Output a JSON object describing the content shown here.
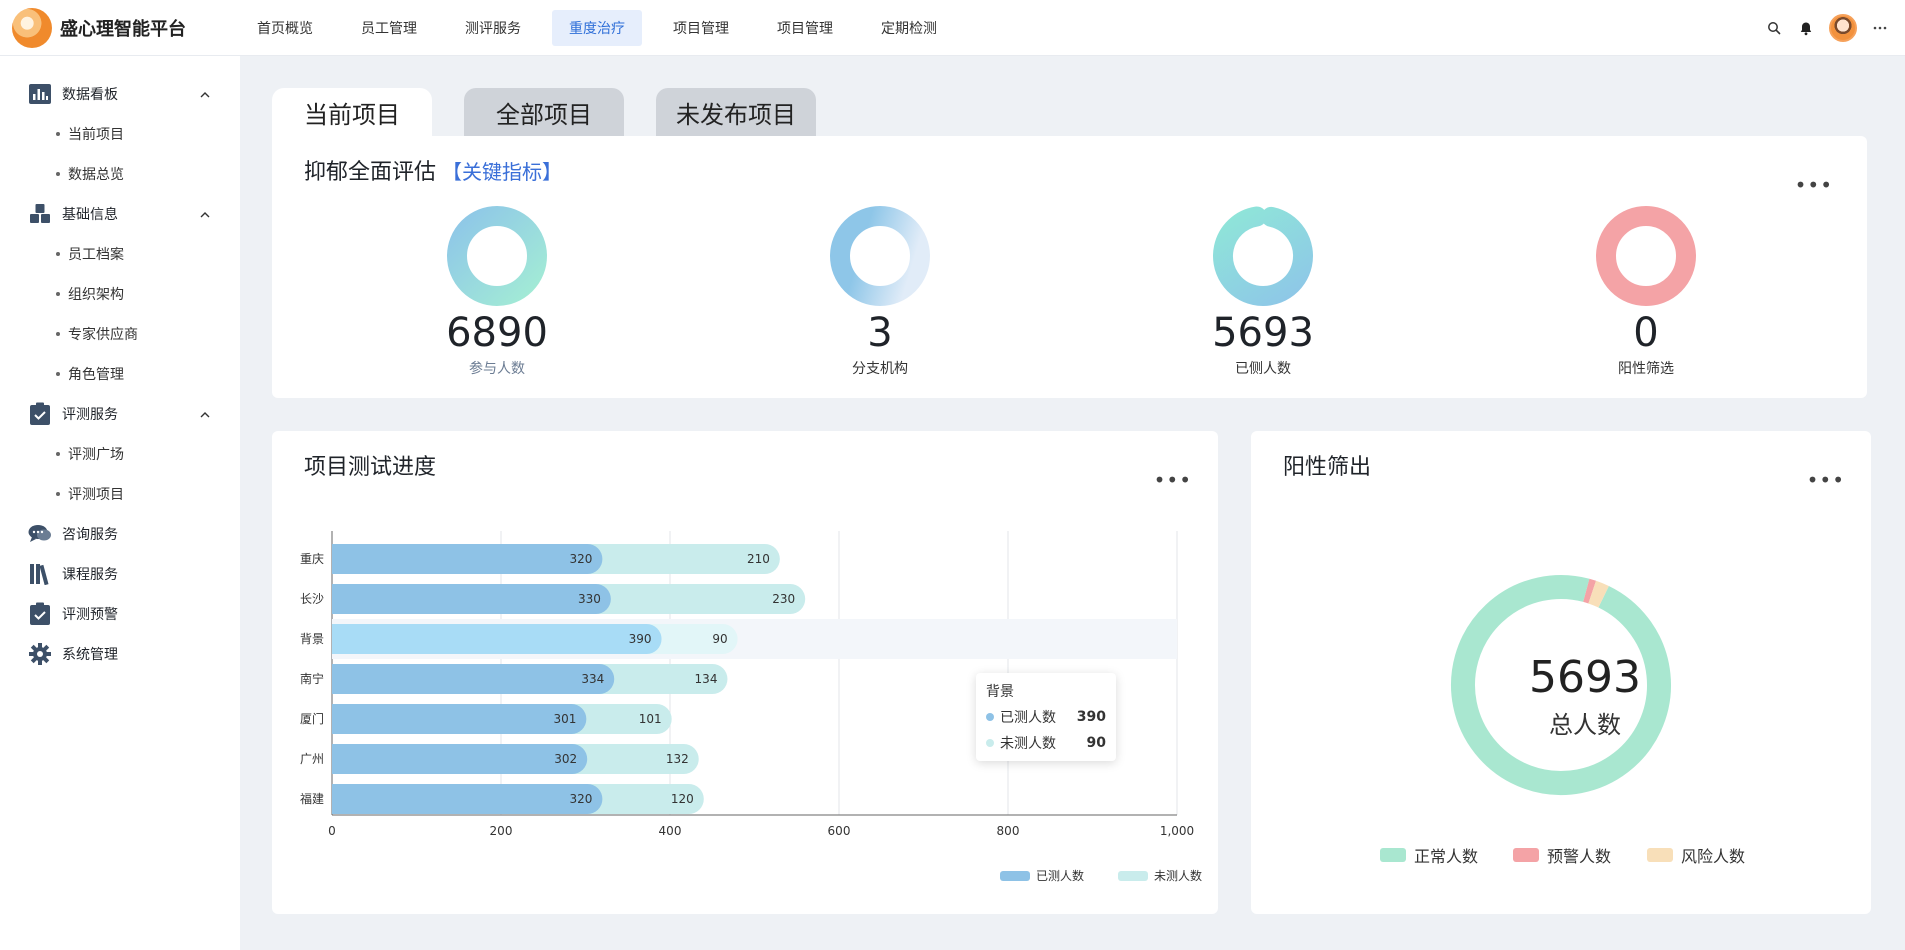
{
  "app": {
    "name": "盛心理智能平台"
  },
  "nav": [
    {
      "label": "首页概览",
      "active": false
    },
    {
      "label": "员工管理",
      "active": false
    },
    {
      "label": "测评服务",
      "active": false
    },
    {
      "label": "重度治疗",
      "active": true
    },
    {
      "label": "项目管理",
      "active": false
    },
    {
      "label": "项目管理",
      "active": false
    },
    {
      "label": "定期检测",
      "active": false
    }
  ],
  "sidebar": {
    "groups": [
      {
        "label": "数据看板",
        "icon": "chart-bar-icon",
        "expanded": true,
        "children": [
          "当前项目",
          "数据总览"
        ]
      },
      {
        "label": "基础信息",
        "icon": "cubes-icon",
        "expanded": true,
        "children": [
          "员工档案",
          "组织架构",
          "专家供应商",
          "角色管理"
        ]
      },
      {
        "label": "评测服务",
        "icon": "clipboard-check-icon",
        "expanded": true,
        "children": [
          "评测广场",
          "评测项目"
        ]
      },
      {
        "label": "咨询服务",
        "icon": "chat-bubbles-icon",
        "expanded": false,
        "children": []
      },
      {
        "label": "课程服务",
        "icon": "books-icon",
        "expanded": false,
        "children": []
      },
      {
        "label": "评测预警",
        "icon": "clipboard-alert-icon",
        "expanded": false,
        "children": []
      },
      {
        "label": "系统管理",
        "icon": "gear-icon",
        "expanded": false,
        "children": []
      }
    ]
  },
  "tabs": [
    {
      "label": "当前项目",
      "active": true
    },
    {
      "label": "全部项目",
      "active": false
    },
    {
      "label": "未发布项目",
      "active": false
    }
  ],
  "assessment": {
    "title": "抑郁全面评估",
    "tag": "【关键指标】",
    "more": "•••",
    "kpis": [
      {
        "value": "6890",
        "label": "参与人数",
        "ring_fill": 1.0,
        "colors": [
          "#8ec6e8",
          "#a3ecd5"
        ]
      },
      {
        "value": "3",
        "label": "分支机构",
        "ring_fill": 1.0,
        "colors": [
          "#8ec6e8",
          "#dde9f6"
        ]
      },
      {
        "value": "5693",
        "label": "已侧人数",
        "ring_fill": 0.94,
        "colors": [
          "#8ec6e8",
          "#8fe6d8"
        ]
      },
      {
        "value": "0",
        "label": "阳性筛选",
        "ring_fill": 1.0,
        "colors": [
          "#f4a3a6",
          "#f4a3a6"
        ]
      }
    ]
  },
  "progress": {
    "title": "项目测试进度",
    "more": "•••",
    "tooltip": {
      "title": "背景",
      "rows": [
        {
          "name": "已测人数",
          "value": "390",
          "color": "#8ec2e6"
        },
        {
          "name": "未测人数",
          "value": "90",
          "color": "#c9ecec"
        }
      ]
    }
  },
  "positive": {
    "title": "阳性筛出",
    "more": "•••",
    "center_value": "5693",
    "center_label": "总人数",
    "legend": [
      {
        "name": "正常人数",
        "color": "#a9e7d0"
      },
      {
        "name": "预警人数",
        "color": "#f4a3a6"
      },
      {
        "name": "风险人数",
        "color": "#f8dfb9"
      }
    ]
  },
  "chart_data": [
    {
      "type": "bar",
      "orientation": "horizontal",
      "stacked": true,
      "categories": [
        "重庆",
        "长沙",
        "背景",
        "南宁",
        "厦门",
        "广州",
        "福建"
      ],
      "series": [
        {
          "name": "已测人数",
          "values": [
            320,
            330,
            390,
            334,
            301,
            302,
            320
          ],
          "color": "#8ec2e6"
        },
        {
          "name": "未测人数",
          "values": [
            210,
            230,
            90,
            134,
            101,
            132,
            120
          ],
          "color": "#c9ecec"
        }
      ],
      "xlim": [
        0,
        1000
      ],
      "xticks": [
        "0",
        "200",
        "400",
        "600",
        "800",
        "1,000"
      ],
      "highlight": "背景",
      "grid": true,
      "legend_position": "bottom-right"
    },
    {
      "type": "pie",
      "style": "donut",
      "slices": [
        {
          "name": "正常人数",
          "value": 5522
        },
        {
          "name": "预警人数",
          "value": 57
        },
        {
          "name": "风险人数",
          "value": 114
        }
      ]
    }
  ]
}
